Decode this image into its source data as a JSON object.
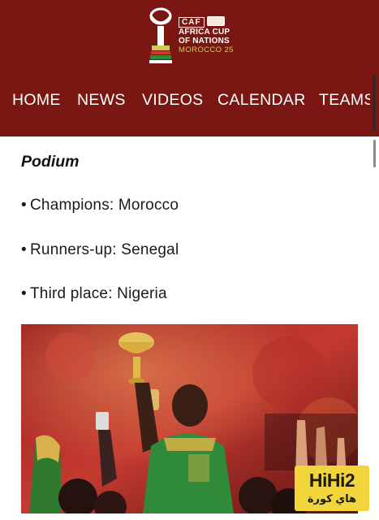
{
  "header": {
    "logo": {
      "brand": "CAF",
      "line1": "AFRICA CUP",
      "line2": "OF NATIONS",
      "host": "MOROCCO 25",
      "brand_color": "#7a1712",
      "host_color": "#c8cf53"
    },
    "nav": [
      "HOME",
      "NEWS",
      "VIDEOS",
      "CALENDAR",
      "TEAMS"
    ]
  },
  "article": {
    "section_title": "Podium",
    "bullet_char": "•",
    "podium": [
      {
        "label": "Champions: Morocco"
      },
      {
        "label": "Runners-up: Senegal"
      },
      {
        "label": "Third place: Nigeria"
      }
    ],
    "photo": {
      "icon": "trophy-celebration-photo",
      "palette": [
        "#8d1c1c",
        "#c23a2e",
        "#d8b24a",
        "#2f7a2f"
      ]
    }
  },
  "watermark": {
    "title": "HiHi2",
    "subtitle": "هاي كورة",
    "color": "#f2d53a"
  }
}
